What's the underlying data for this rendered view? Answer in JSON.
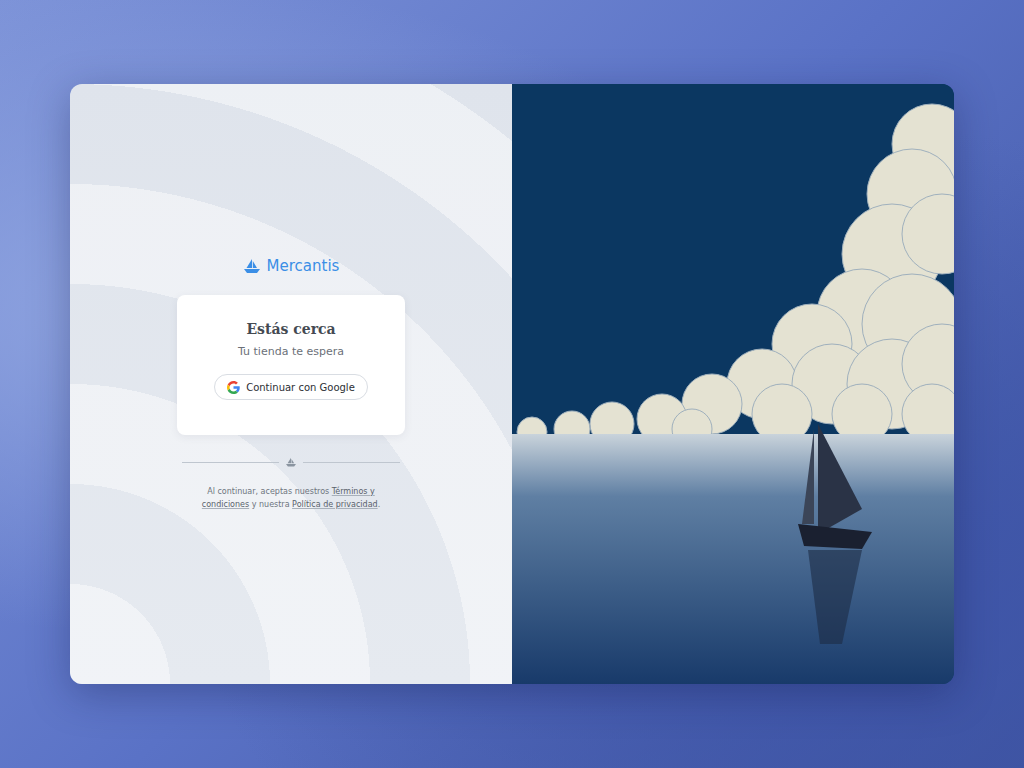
{
  "brand": {
    "name": "Mercantis"
  },
  "card": {
    "title": "Estás cerca",
    "subtitle": "Tu tienda te espera",
    "button": "Continuar con Google"
  },
  "legal": {
    "before": "Al continuar, aceptas nuestros ",
    "terms": "Términos y condiciones",
    "middle": " y nuestra ",
    "privacy": "Política de privacidad",
    "after": "."
  }
}
